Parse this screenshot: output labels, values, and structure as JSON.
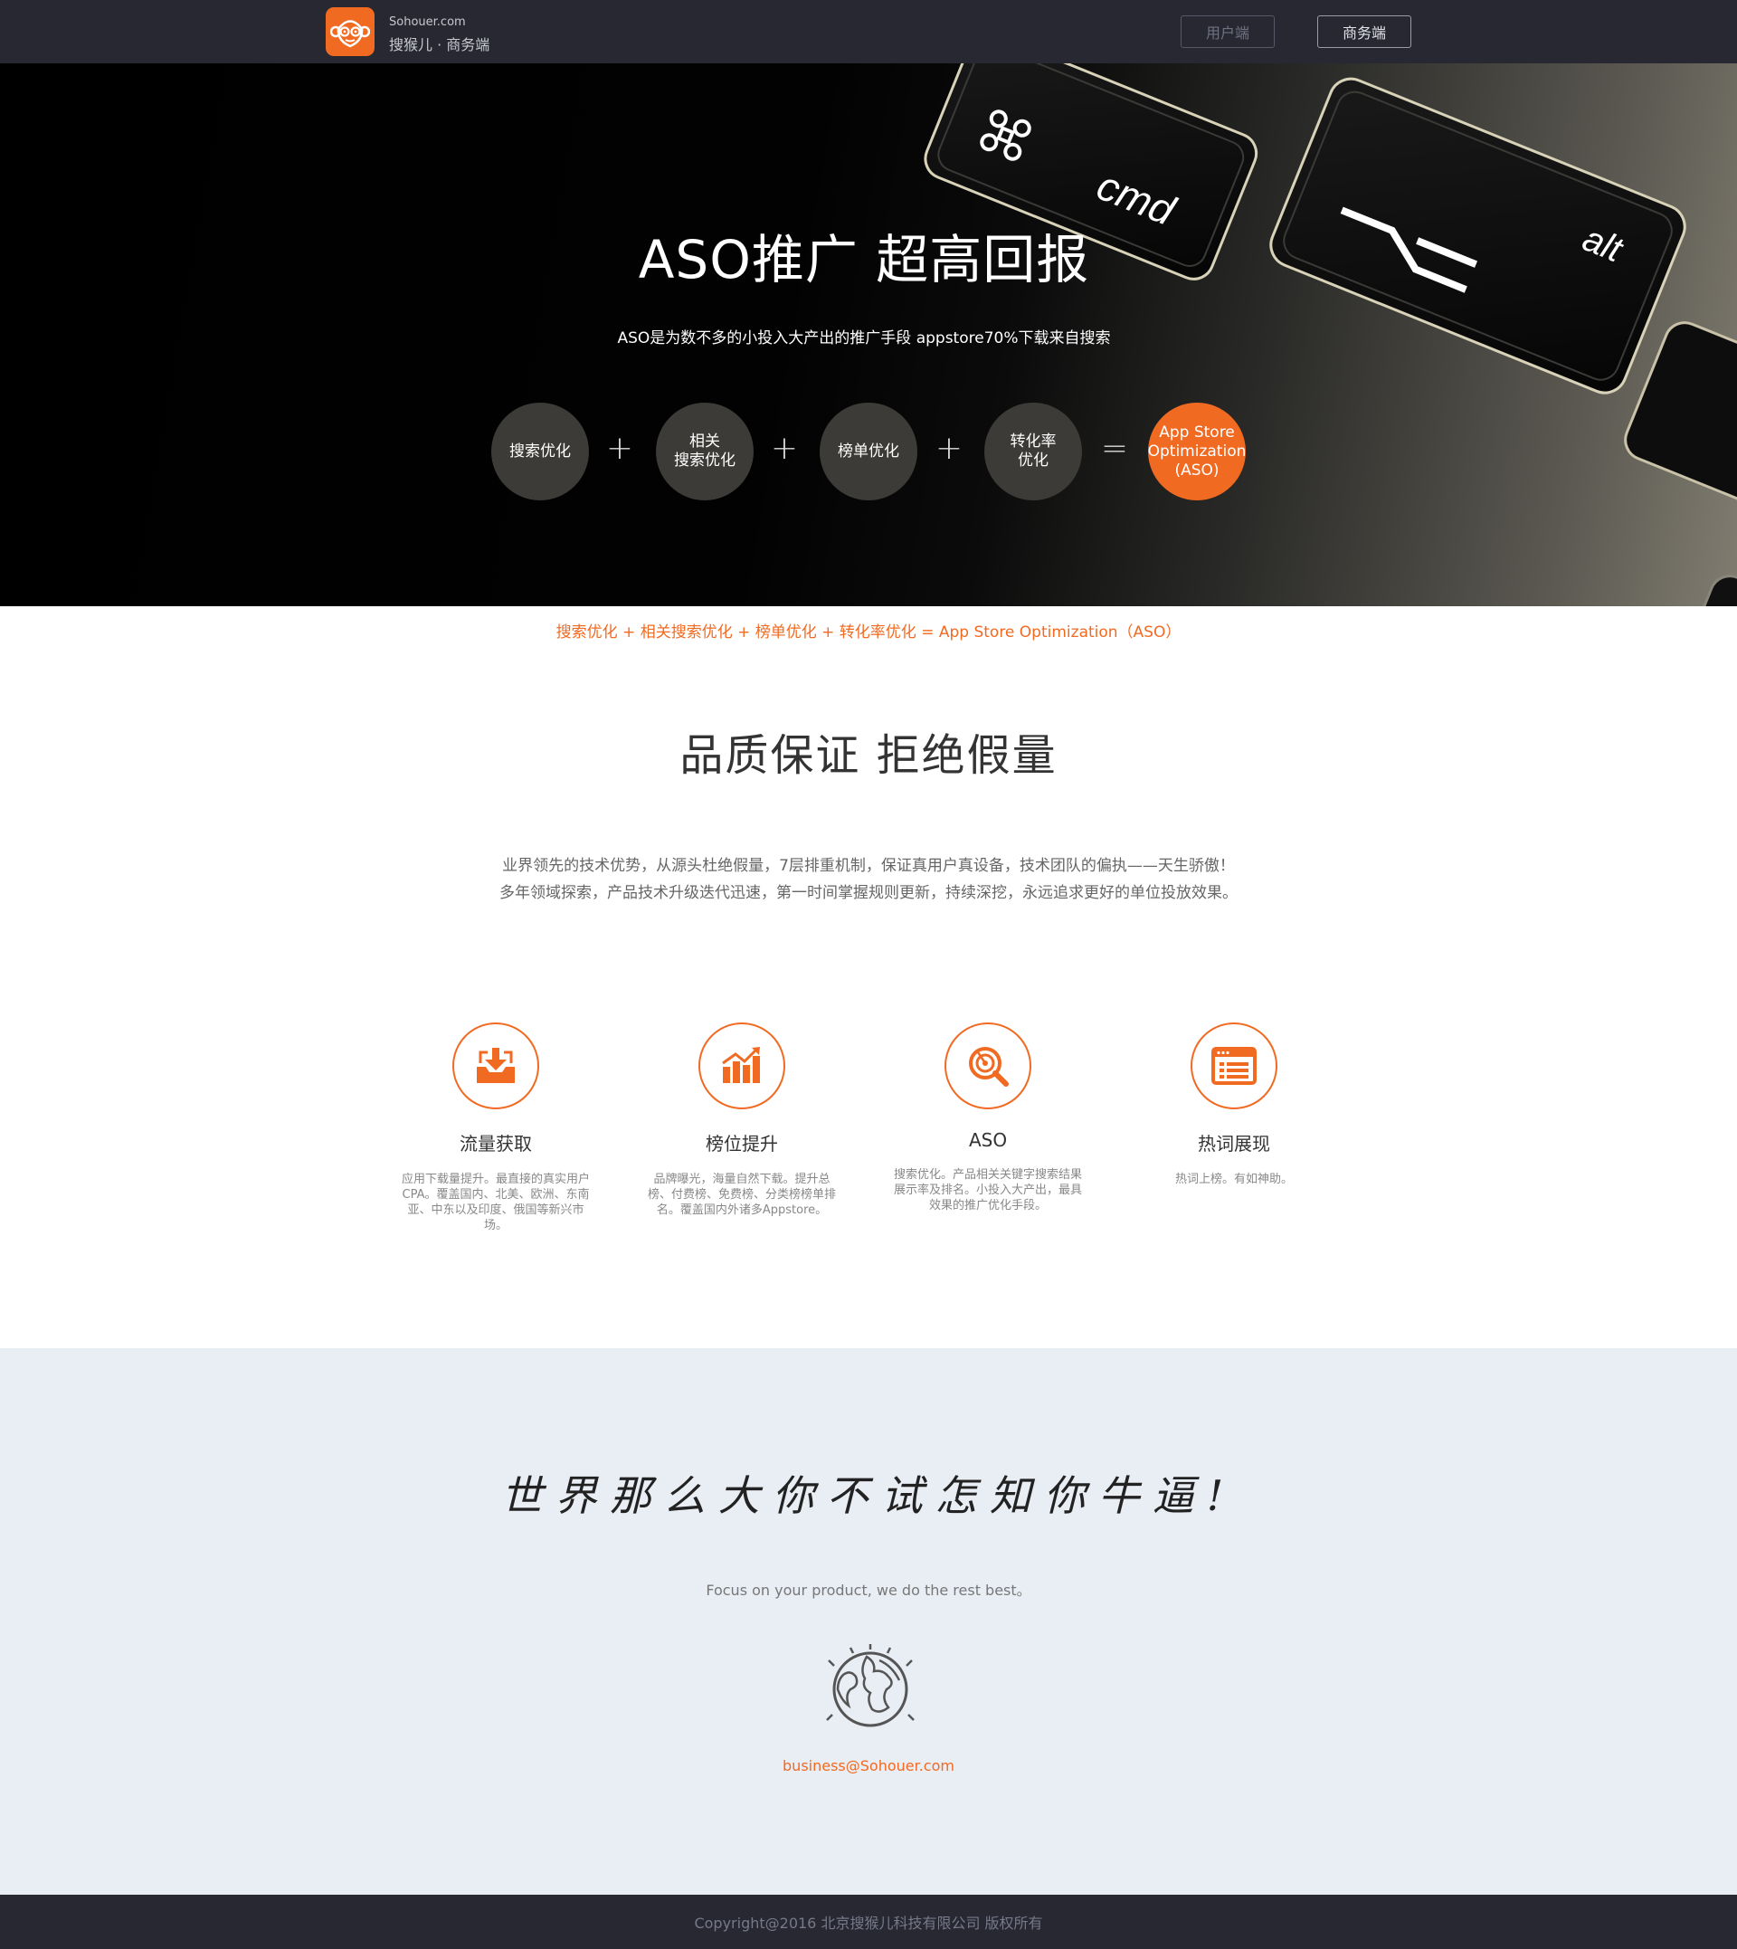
{
  "header": {
    "domain": "Sohouer.com",
    "brand": "搜猴儿 · 商务端",
    "user_button": "用户端",
    "biz_button": "商务端"
  },
  "hero": {
    "title": "ASO推广   超高回报",
    "subtitle": "ASO是为数不多的小投入大产出的推广手段  appstore70%下载来自搜索",
    "key_labels": [
      "cmd",
      "alt"
    ],
    "bubbles": [
      {
        "label": "搜索优化"
      },
      {
        "label": "相关\n搜索优化"
      },
      {
        "label": "榜单优化"
      },
      {
        "label": "转化率\n优化"
      },
      {
        "label": "App Store\nOptimization\n(ASO)"
      }
    ],
    "operators": [
      "+",
      "+",
      "+",
      "="
    ]
  },
  "formula_text": "搜索优化 + 相关搜索优化 + 榜单优化  + 转化率优化  = App Store Optimization（ASO）",
  "quality": {
    "title": "品质保证   拒绝假量",
    "desc_lines": [
      "业界领先的技术优势，从源头杜绝假量，7层排重机制，保证真用户真设备，技术团队的偏执——天生骄傲！",
      "多年领域探索，产品技术升级迭代迅速，第一时间掌握规则更新，持续深挖，永远追求更好的单位投放效果。"
    ],
    "features": [
      {
        "title": "流量获取",
        "desc": "应用下载量提升。最直接的真实用户CPA。覆盖国内、北美、欧洲、东南亚、中东以及印度、俄国等新兴市场。"
      },
      {
        "title": "榜位提升",
        "desc": "品牌曝光，海量自然下载。提升总榜、付费榜、免费榜、分类榜榜单排名。覆盖国内外诸多Appstore。"
      },
      {
        "title": "ASO",
        "desc": "搜索优化。产品相关关键字搜索结果展示率及排名。小投入大产出，最具效果的推广优化手段。"
      },
      {
        "title": "热词展现",
        "desc": "热词上榜。有如神助。"
      }
    ]
  },
  "slogan": {
    "text": "世界那么大你不试怎知你牛逼!",
    "focus": "Focus on your product, we do the rest best。",
    "email": "business@Sohouer.com"
  },
  "footer": {
    "copyright": "Copyright@2016 北京搜猴儿科技有限公司 版权所有"
  },
  "colors": {
    "accent": "#f16a22",
    "topbar": "#272832",
    "slogan_bg": "#e9edf4"
  },
  "icons": [
    "monkey-logo-icon",
    "download-tray-icon",
    "bar-chart-up-icon",
    "target-search-icon",
    "browser-list-icon",
    "globe-icon"
  ]
}
